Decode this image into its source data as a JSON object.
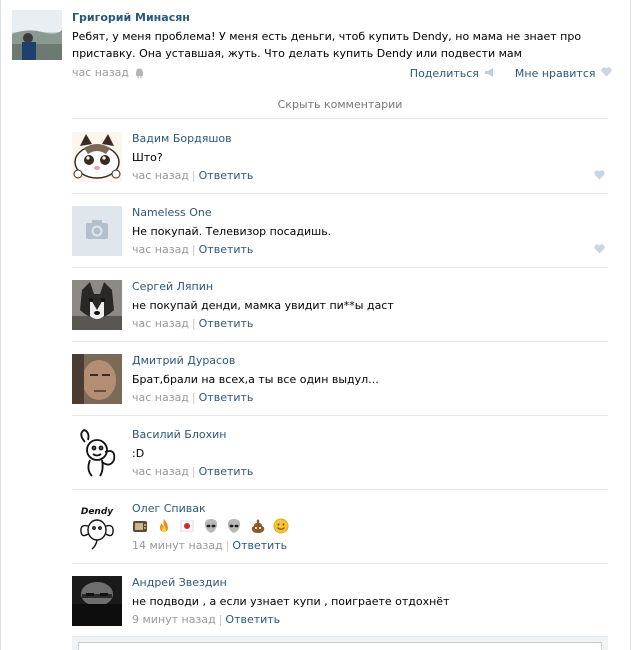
{
  "post": {
    "author": "Григорий Минасян",
    "text": "Ребят, у меня проблема! У меня есть деньги, чтоб купить Dendy, но мама не знает про приставку. Она уставшая, жуть. Что делать купить Dendy или подвести мам",
    "time": "час назад",
    "share_label": "Поделиться",
    "like_label": "Мне нравится",
    "icons": {
      "platform": "android-icon",
      "share": "megaphone-icon",
      "like": "heart-icon"
    }
  },
  "hide_comments_label": "Скрыть комментарии",
  "comments": [
    {
      "author": "Вадим Бордяшов",
      "text": "Што?",
      "time": "час назад",
      "reply": "Ответить",
      "liked_icon": true
    },
    {
      "author": "Nameless One",
      "text": "Не покупай. Телевизор посадишь.",
      "time": "час назад",
      "reply": "Ответить",
      "liked_icon": true
    },
    {
      "author": "Сергей Ляпин",
      "text": "не покупай денди, мамка увидит пи**ы даст",
      "time": "час назад",
      "reply": "Ответить",
      "liked_icon": false
    },
    {
      "author": "Дмитрий Дурасов",
      "text": "Брат,брали на всех,а ты все один выдул...",
      "time": "час назад",
      "reply": "Ответить",
      "liked_icon": false
    },
    {
      "author": "Василий Блохин",
      "text": ":D",
      "time": "час назад",
      "reply": "Ответить",
      "liked_icon": false
    },
    {
      "author": "Олег Спивак",
      "text": "",
      "emojis": [
        "tv-emoji",
        "fire-emoji",
        "flag-emoji",
        "alien-emoji",
        "alien-emoji",
        "poop-emoji",
        "smile-emoji"
      ],
      "time": "14 минут назад",
      "reply": "Ответить",
      "liked_icon": false,
      "avatar_text": "Dendy"
    },
    {
      "author": "Андрей Звездин",
      "text": "не подводи , а если узнает купи , поиграете отдохнёт",
      "time": "9 минут назад",
      "reply": "Ответить",
      "liked_icon": false
    }
  ],
  "colors": {
    "link": "#2b587a",
    "meta": "#999999",
    "divider": "#e4e8ed",
    "like_heart": "#c8d6e3"
  }
}
